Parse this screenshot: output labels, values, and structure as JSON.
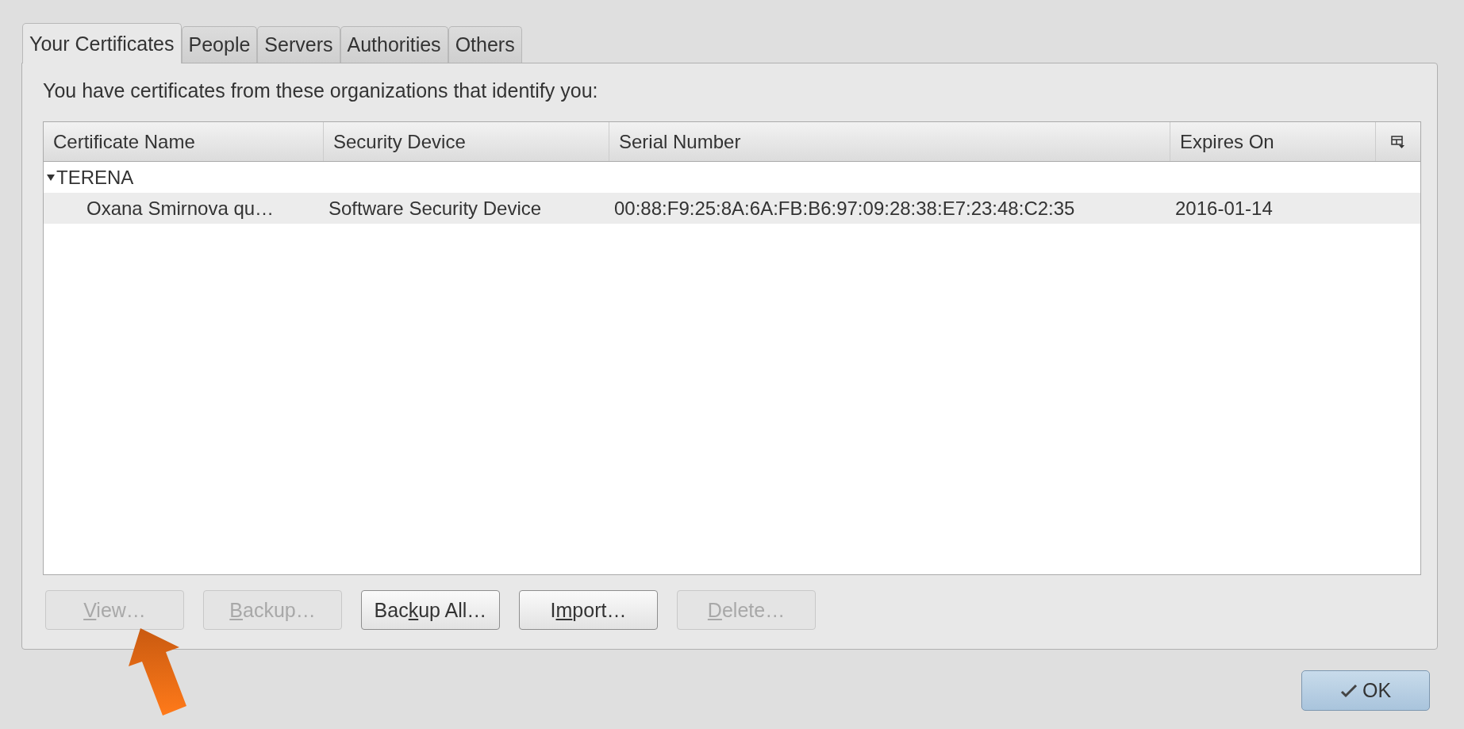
{
  "tabs": [
    {
      "label": "Your Certificates",
      "selected": true
    },
    {
      "label": "People",
      "selected": false
    },
    {
      "label": "Servers",
      "selected": false
    },
    {
      "label": "Authorities",
      "selected": false
    },
    {
      "label": "Others",
      "selected": false
    }
  ],
  "intro": "You have certificates from these organizations that identify you:",
  "table": {
    "columns": [
      "Certificate Name",
      "Security Device",
      "Serial Number",
      "Expires On"
    ],
    "rows": [
      {
        "name": "TERENA",
        "expanded": true,
        "children": [
          {
            "cells": [
              "Oxana Smirnova qu…",
              "Software Security Device",
              "00:88:F9:25:8A:6A:FB:B6:97:09:28:38:E7:23:48:C2:35",
              "2016-01-14"
            ]
          }
        ]
      }
    ]
  },
  "buttons": [
    {
      "key": "V",
      "after": "iew…",
      "disabled": true
    },
    {
      "key": "B",
      "after": "ackup…",
      "disabled": true
    },
    {
      "before": "Bac",
      "key": "k",
      "after": "up All…",
      "disabled": false
    },
    {
      "before": "I",
      "key": "m",
      "after": "port…",
      "disabled": false
    },
    {
      "key": "D",
      "after": "elete…",
      "disabled": true
    }
  ],
  "ok": "OK"
}
